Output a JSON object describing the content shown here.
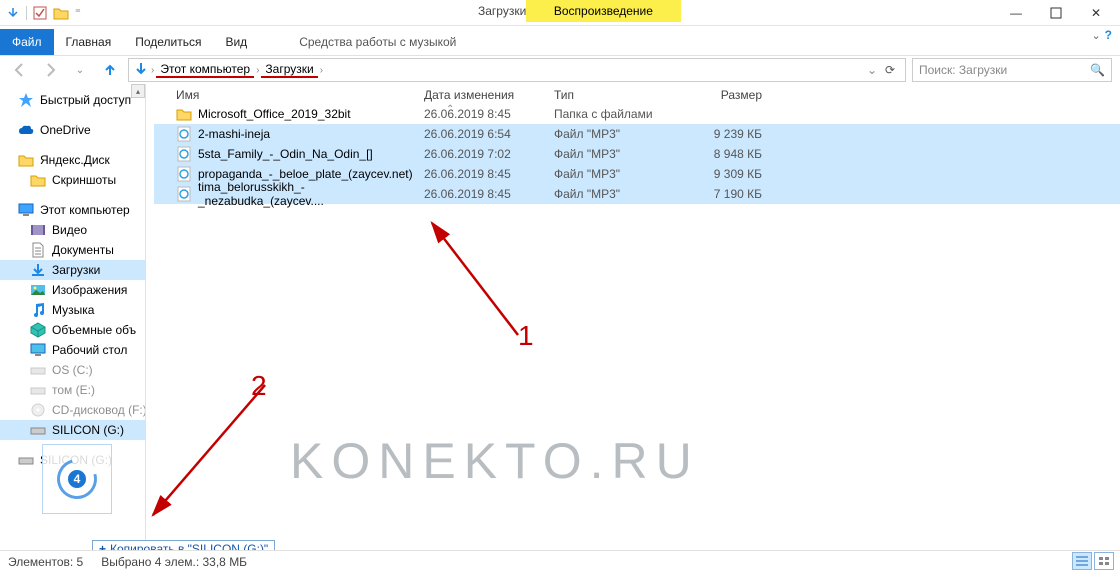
{
  "window": {
    "title": "Загрузки",
    "context_tab": "Воспроизведение",
    "ribbon_context": "Средства работы с музыкой",
    "tabs": {
      "file": "Файл",
      "home": "Главная",
      "share": "Поделиться",
      "view": "Вид"
    }
  },
  "address": {
    "root": "Этот компьютер",
    "folder": "Загрузки"
  },
  "search": {
    "placeholder": "Поиск: Загрузки"
  },
  "nav": {
    "quick": "Быстрый доступ",
    "onedrive": "OneDrive",
    "yadisk": "Яндекс.Диск",
    "screenshots": "Скриншоты",
    "pc": "Этот компьютер",
    "video": "Видео",
    "docs": "Документы",
    "downloads": "Загрузки",
    "pictures": "Изображения",
    "music": "Музыка",
    "objects3d": "Объемные объ",
    "desktop": "Рабочий стол",
    "osc": "OS (C:)",
    "tom_e": "том (E:)",
    "dvd": "CD-дисковод (F:)",
    "silicon": "SILICON (G:)",
    "silicon2": "SILICON (G:)"
  },
  "columns": {
    "name": "Имя",
    "date": "Дата изменения",
    "type": "Тип",
    "size": "Размер"
  },
  "rows": [
    {
      "icon": "folder",
      "name": "Microsoft_Office_2019_32bit",
      "date": "26.06.2019 8:45",
      "type": "Папка с файлами",
      "size": "",
      "sel": false
    },
    {
      "icon": "mp3",
      "name": "2-mashi-ineja",
      "date": "26.06.2019 6:54",
      "type": "Файл \"MP3\"",
      "size": "9 239 КБ",
      "sel": true
    },
    {
      "icon": "mp3",
      "name": "5sta_Family_-_Odin_Na_Odin_[]",
      "date": "26.06.2019 7:02",
      "type": "Файл \"MP3\"",
      "size": "8 948 КБ",
      "sel": true
    },
    {
      "icon": "mp3",
      "name": "propaganda_-_beloe_plate_(zaycev.net)",
      "date": "26.06.2019 8:45",
      "type": "Файл \"MP3\"",
      "size": "9 309 КБ",
      "sel": true
    },
    {
      "icon": "mp3",
      "name": "tima_belorusskikh_-_nezabudka_(zaycev....",
      "date": "26.06.2019 8:45",
      "type": "Файл \"MP3\"",
      "size": "7 190 КБ",
      "sel": true
    }
  ],
  "drag": {
    "count": "4",
    "tip": "Копировать в \"SILICON (G:)\""
  },
  "status": {
    "count": "Элементов: 5",
    "sel": "Выбрано 4 элем.: 33,8 МБ"
  },
  "watermark": "KONEKTO.RU",
  "ann": {
    "n1": "1",
    "n2": "2"
  }
}
